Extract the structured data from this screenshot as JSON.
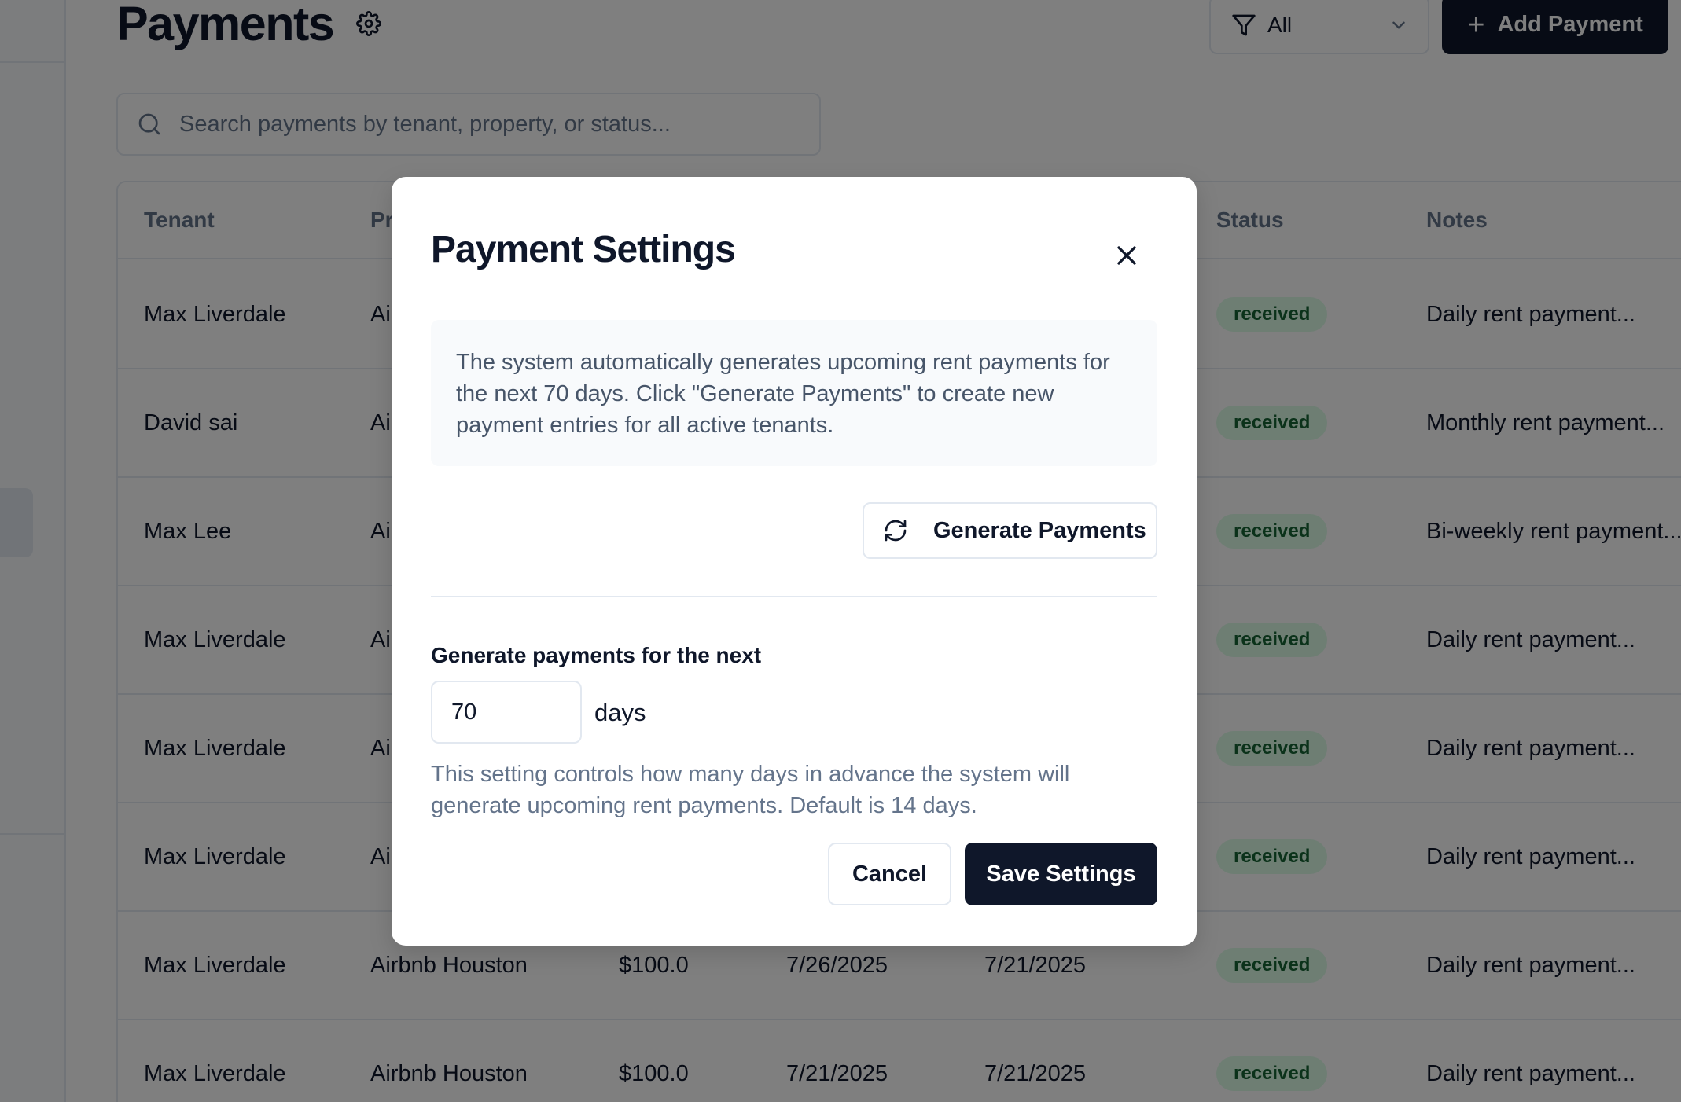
{
  "header": {
    "title": "Payments",
    "settings_icon": "gear-icon",
    "filter": {
      "icon": "filter-icon",
      "value": "All",
      "chevron_icon": "chevron-down-icon"
    },
    "add_button": {
      "icon": "plus-icon",
      "label": "Add Payment"
    }
  },
  "search": {
    "icon": "search-icon",
    "placeholder": "Search payments by tenant, property, or status..."
  },
  "table": {
    "columns": [
      "Tenant",
      "Pr",
      "Status",
      "Notes"
    ],
    "rows": [
      {
        "tenant": "Max Liverdale",
        "property": "Air",
        "amount": "",
        "date1": "",
        "date2": "",
        "status": "received",
        "notes": "Daily rent payment..."
      },
      {
        "tenant": "David sai",
        "property": "Air",
        "amount": "",
        "date1": "",
        "date2": "",
        "status": "received",
        "notes": "Monthly rent payment..."
      },
      {
        "tenant": "Max Lee",
        "property": "Air",
        "amount": "",
        "date1": "",
        "date2": "",
        "status": "received",
        "notes": "Bi-weekly rent payment..."
      },
      {
        "tenant": "Max Liverdale",
        "property": "Air",
        "amount": "",
        "date1": "",
        "date2": "",
        "status": "received",
        "notes": "Daily rent payment..."
      },
      {
        "tenant": "Max Liverdale",
        "property": "Air",
        "amount": "",
        "date1": "",
        "date2": "",
        "status": "received",
        "notes": "Daily rent payment..."
      },
      {
        "tenant": "Max Liverdale",
        "property": "Air",
        "amount": "",
        "date1": "",
        "date2": "",
        "status": "received",
        "notes": "Daily rent payment..."
      },
      {
        "tenant": "Max Liverdale",
        "property": "Airbnb Houston",
        "amount": "$100.0",
        "date1": "7/26/2025",
        "date2": "7/21/2025",
        "status": "received",
        "notes": "Daily rent payment..."
      },
      {
        "tenant": "Max Liverdale",
        "property": "Airbnb Houston",
        "amount": "$100.0",
        "date1": "7/21/2025",
        "date2": "7/21/2025",
        "status": "received",
        "notes": "Daily rent payment..."
      }
    ]
  },
  "modal": {
    "title": "Payment Settings",
    "close_icon": "close-icon",
    "info_text": "The system automatically generates upcoming rent payments for the next 70 days. Click \"Generate Payments\" to create new payment entries for all active tenants.",
    "generate_button": {
      "icon": "refresh-icon",
      "label": "Generate Payments"
    },
    "field_label": "Generate payments for the next",
    "days_value": "70",
    "days_unit": "days",
    "help_text": "This setting controls how many days in advance the system will generate upcoming rent payments. Default is 14 days.",
    "cancel_label": "Cancel",
    "save_label": "Save Settings"
  }
}
